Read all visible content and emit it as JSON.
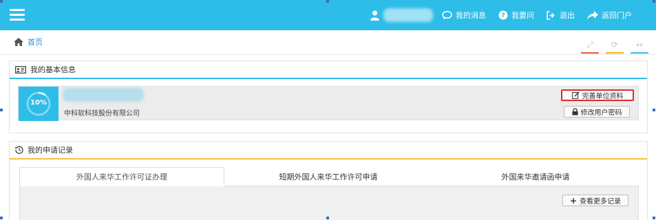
{
  "topbar": {
    "nav": [
      {
        "label": "我的消息",
        "icon": "chat-icon"
      },
      {
        "label": "我要问",
        "icon": "question-icon"
      },
      {
        "label": "退出",
        "icon": "logout-icon"
      },
      {
        "label": "返回门户",
        "icon": "share-arrow-icon"
      }
    ]
  },
  "breadcrumb": {
    "home": "首页"
  },
  "basic_info": {
    "title": "我的基本信息",
    "progress": "10%",
    "progress_value": 0.1,
    "company": "中科软科技股份有限公司",
    "complete_button": "完善单位资料",
    "password_button": "修改用户密码"
  },
  "applications": {
    "title": "我的申请记录",
    "tabs": [
      "外国人来华工作许可证办理",
      "短期外国人来华工作许可申请",
      "外国来华邀请函申请"
    ],
    "more_button": "查看更多记录"
  },
  "colors": {
    "accent": "#2ebde8",
    "highlight": "#e02b2b",
    "warning": "#f4c042"
  }
}
